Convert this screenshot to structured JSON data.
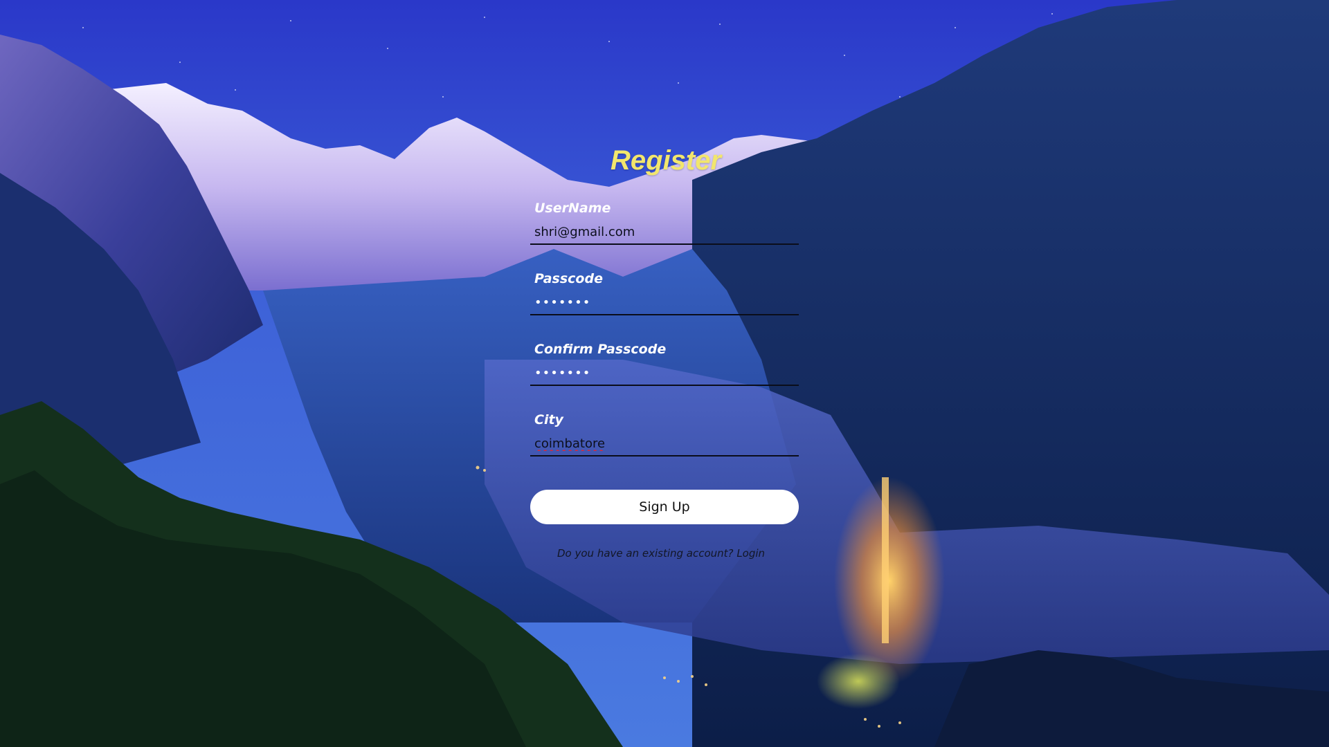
{
  "background": {
    "description_icon": "mountain-valley-night-photo-icon"
  },
  "form": {
    "title": "Register",
    "fields": [
      {
        "label": "UserName",
        "value": "shri@gmail.com",
        "type": "text"
      },
      {
        "label": "Passcode",
        "value": "•••••••",
        "type": "password"
      },
      {
        "label": "Confirm Passcode",
        "value": "•••••••",
        "type": "password"
      },
      {
        "label": "City",
        "value": "coimbatore",
        "type": "text"
      }
    ],
    "submit_label": "Sign Up",
    "existing_prompt": "Do you have an existing account?",
    "login_link": "Login"
  },
  "colors": {
    "title": "#f2e66d",
    "label": "#ffffff",
    "button_bg": "#ffffff",
    "underline": "#0a0d1a"
  }
}
